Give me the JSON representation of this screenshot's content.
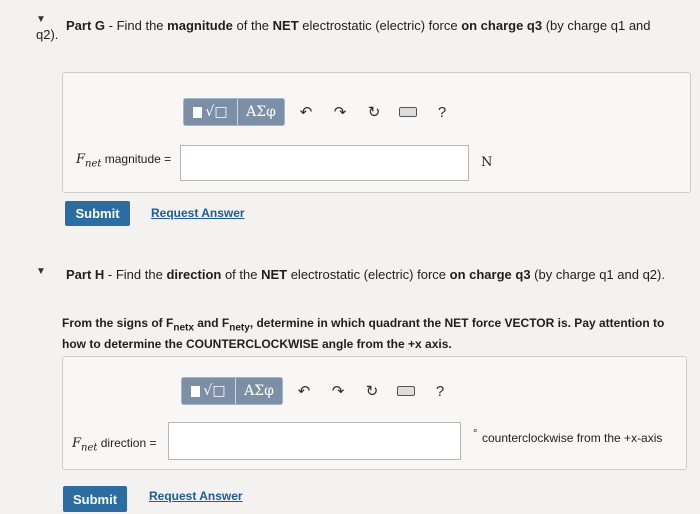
{
  "part_g": {
    "title_prefix": "Part G",
    "title_sep": " - Find the ",
    "w1": "magnitude",
    "t2": " of the ",
    "w2": "NET",
    "t3": " electrostatic (electric) force ",
    "w3": "on charge q3",
    "t4": " (by charge q1 and",
    "t5": "q2).",
    "label_var": "F",
    "label_sub": "net",
    "label_rest": " magnitude = ",
    "unit": "N",
    "submit": "Submit",
    "request": "Request Answer"
  },
  "part_h": {
    "title_prefix": "Part H",
    "title_sep": " - Find the ",
    "w1": "direction",
    "t2": " of the ",
    "w2": "NET",
    "t3": " electrostatic (electric) force ",
    "w3": "on charge q3",
    "t4": " (by charge q1 and q2).",
    "instr_a": "From the signs of F",
    "instr_sub1": "netx",
    "instr_b": " and F",
    "instr_sub2": "nety",
    "instr_c": ", determine in which quadrant the NET force VECTOR is. Pay attention to",
    "instr_line2": "how to determine the COUNTERCLOCKWISE angle from the +x axis.",
    "label_var": "F",
    "label_sub": "net",
    "label_rest": " direction = ",
    "unit_deg": "°",
    "unit_text": "counterclockwise from the +x-axis",
    "submit": "Submit",
    "request": "Request Answer"
  },
  "toolbar": {
    "templates_glyph": "√□",
    "greek": "ΑΣφ",
    "undo": "↶",
    "redo": "↷",
    "reset": "↻",
    "help": "?"
  }
}
